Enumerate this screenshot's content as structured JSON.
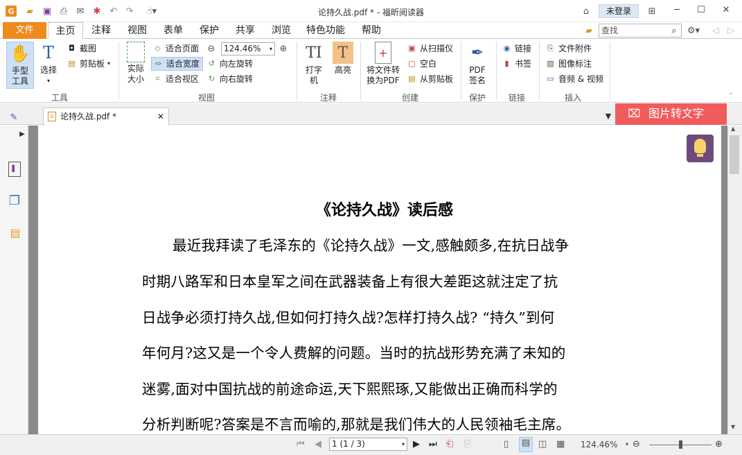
{
  "app": {
    "title": "论持久战.pdf * - 福昕阅读器",
    "login_label": "未登录",
    "search_placeholder": "查找",
    "accent": "#ef8a1c"
  },
  "menu": {
    "file": "文件",
    "tabs": [
      "主页",
      "注释",
      "视图",
      "表单",
      "保护",
      "共享",
      "浏览",
      "特色功能",
      "帮助"
    ]
  },
  "ribbon": {
    "tools": {
      "hand": "手型工具",
      "select": "选择",
      "screenshot": "截图",
      "clipboard": "剪贴板",
      "group": "工具"
    },
    "view": {
      "actual_size": "实际大小",
      "fit_page": "适合页面",
      "fit_width": "适合宽度",
      "fit_visible": "适合视区",
      "zoom_value": "124.46%",
      "rotate_left": "向左旋转",
      "rotate_right": "向右旋转",
      "group": "视图"
    },
    "comment": {
      "typewriter": "打字机",
      "highlight": "高亮",
      "group": "注释"
    },
    "create": {
      "convert": "将文件转换为PDF",
      "from_scanner": "从扫描仪",
      "blank": "空白",
      "from_clipboard": "从剪贴板",
      "group": "创建"
    },
    "protect": {
      "sign": "PDF签名",
      "group": "保护"
    },
    "links": {
      "link": "链接",
      "bookmark": "书签",
      "group": "链接"
    },
    "insert": {
      "attachment": "文件附件",
      "image_annot": "图像标注",
      "audio_video": "音频 & 视频",
      "group": "插入"
    }
  },
  "tabs": {
    "doc_tab": "论持久战.pdf *",
    "ocr_button": "图片转文字",
    "ocr_color": "#f05c5c"
  },
  "document": {
    "title": "《论持久战》读后感",
    "lines": [
      "最近我拜读了毛泽东的《论持久战》一文,感触颇多,在抗日战争",
      "时期八路军和日本皇军之间在武器装备上有很大差距这就注定了抗",
      "日战争必须打持久战,但如何打持久战?怎样打持久战? “持久”到何",
      "年何月?这又是一个令人费解的问题。当时的抗战形势充满了未知的",
      "迷雾,面对中国抗战的前途命运,天下熙熙琢,又能做出正确而科学的",
      "分析判断呢?答案是不言而喻的,那就是我们伟大的人民领袖毛主席。"
    ]
  },
  "status": {
    "page_selector": "1 (1 / 3)",
    "zoom": "124.46%"
  }
}
